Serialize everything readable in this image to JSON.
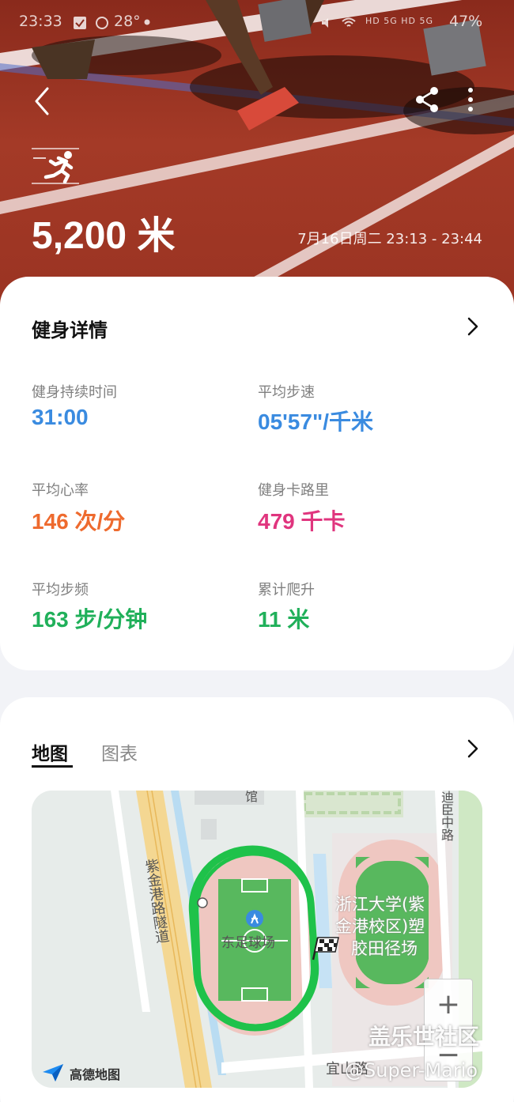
{
  "status_bar": {
    "time": "23:33",
    "temperature": "28°",
    "network": "HD 5G HD 5G",
    "battery": "47%"
  },
  "header": {
    "distance": "5,200 米",
    "datetime": "7月16日周二 23:13 - 23:44",
    "icons": [
      "back-icon",
      "share-icon",
      "more-icon",
      "running-icon"
    ]
  },
  "details": {
    "title": "健身详情",
    "stats": [
      {
        "label": "健身持续时间",
        "value": "31:00",
        "color": "#3a8be0"
      },
      {
        "label": "平均步速",
        "value": "05'57\"/千米",
        "color": "#3a8be0"
      },
      {
        "label": "平均心率",
        "value": "146 次/分",
        "color": "#ee6a2e"
      },
      {
        "label": "健身卡路里",
        "value": "479 千卡",
        "color": "#e0357e"
      },
      {
        "label": "平均步频",
        "value": "163 步/分钟",
        "color": "#20b05a"
      },
      {
        "label": "累计爬升",
        "value": "11 米",
        "color": "#20b05a"
      }
    ]
  },
  "map_section": {
    "tabs": [
      {
        "label": "地图",
        "active": true
      },
      {
        "label": "图表",
        "active": false
      }
    ],
    "labels": {
      "road_vertical": "紫金港路隧道",
      "field": "东足球场",
      "campus": "浙江大学(紫金港校区)塑胶田径场",
      "campus_line1": "浙江大学(紫",
      "campus_line2": "金港校区)塑",
      "campus_line3": "胶田径场",
      "top_road": "迪臣中路",
      "top_building": "馆",
      "bottom_road": "宜山路"
    },
    "zoom_in": "+",
    "zoom_out": "−",
    "provider": "高德地图",
    "route_color": "#1fc24a"
  },
  "watermark": {
    "line1": "盖乐世社区",
    "line2": "@Super-Mario"
  }
}
